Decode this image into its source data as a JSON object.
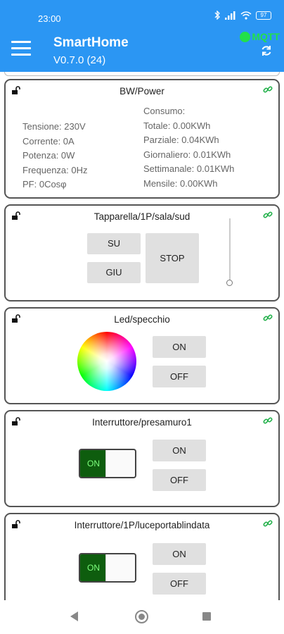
{
  "status_bar": {
    "time": "23:00",
    "battery": "97"
  },
  "app_bar": {
    "title": "SmartHome",
    "version": "V0.7.0 (24)",
    "mqtt_label": "MQTT"
  },
  "colors": {
    "app_bar": "#2b96f3",
    "mqtt_status": "#22e04a",
    "switch_on": "#0e5d0e",
    "link_icon": "#22b04a"
  },
  "icons": [
    "menu-icon",
    "refresh-icon",
    "lock-open-icon",
    "link-icon",
    "back-icon",
    "home-icon",
    "recents-icon"
  ],
  "power_card": {
    "title": "BW/Power",
    "left": [
      "Tensione: 230V",
      "Corrente: 0A",
      "Potenza: 0W",
      "Frequenza: 0Hz",
      "PF: 0Cosφ"
    ],
    "right": [
      "Consumo:",
      "Totale: 0.00KWh",
      "Parziale: 0.04KWh",
      "Giornaliero: 0.01KWh",
      "Settimanale: 0.01KWh",
      "Mensile: 0.00KWh"
    ]
  },
  "shutter_card": {
    "title": "Tapparella/1P/sala/sud",
    "up_label": "SU",
    "down_label": "GIU",
    "stop_label": "STOP",
    "position": 0
  },
  "led_card": {
    "title": "Led/specchio",
    "on_label": "ON",
    "off_label": "OFF"
  },
  "switch_card_1": {
    "title": "Interruttore/presamuro1",
    "state_label": "ON",
    "on_label": "ON",
    "off_label": "OFF"
  },
  "switch_card_2": {
    "title": "Interruttore/1P/luceportablindata",
    "state_label": "ON",
    "on_label": "ON",
    "off_label": "OFF"
  }
}
